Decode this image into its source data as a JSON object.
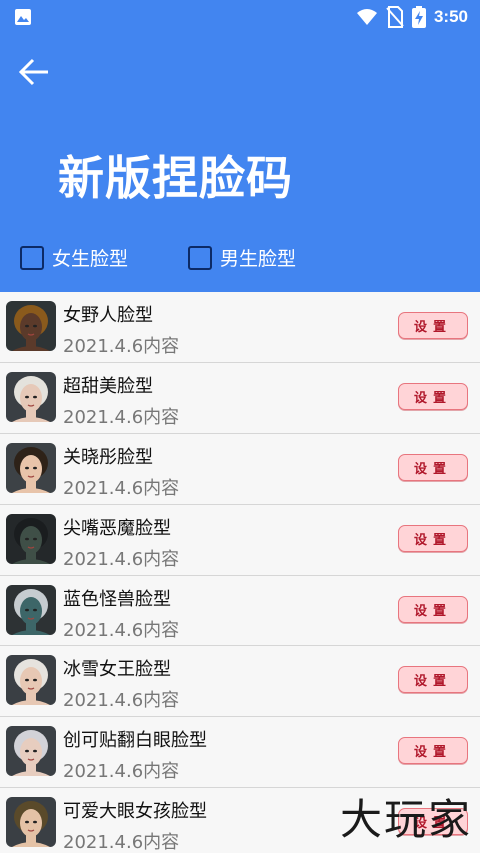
{
  "status_bar": {
    "time": "3:50"
  },
  "header": {
    "title": "新版捏脸码"
  },
  "filters": [
    {
      "label": "女生脸型",
      "checked": false
    },
    {
      "label": "男生脸型",
      "checked": false
    }
  ],
  "set_label": "设置",
  "items": [
    {
      "name": "女野人脸型",
      "date": "2021.4.6内容",
      "hair": "#8a5a1c",
      "skin": "#5b3a2a",
      "bg": "#2e3436"
    },
    {
      "name": "超甜美脸型",
      "date": "2021.4.6内容",
      "hair": "#e4e2dc",
      "skin": "#e6c9b8",
      "bg": "#3a3f44"
    },
    {
      "name": "关晓彤脸型",
      "date": "2021.4.6内容",
      "hair": "#2e2218",
      "skin": "#e8c4aa",
      "bg": "#3d4246"
    },
    {
      "name": "尖嘴恶魔脸型",
      "date": "2021.4.6内容",
      "hair": "#1a1d1f",
      "skin": "#3f4f47",
      "bg": "#24282a"
    },
    {
      "name": "蓝色怪兽脸型",
      "date": "2021.4.6内容",
      "hair": "#c6ccd0",
      "skin": "#3d6668",
      "bg": "#2d3234"
    },
    {
      "name": "冰雪女王脸型",
      "date": "2021.4.6内容",
      "hair": "#e6e3de",
      "skin": "#e7c8b4",
      "bg": "#3a3f44"
    },
    {
      "name": "创可贴翻白眼脸型",
      "date": "2021.4.6内容",
      "hair": "#d2d2d8",
      "skin": "#e7cdbf",
      "bg": "#3b4045"
    },
    {
      "name": "可爱大眼女孩脸型",
      "date": "2021.4.6内容",
      "hair": "#5a4a2a",
      "skin": "#e4c2a6",
      "bg": "#3a3f44"
    }
  ],
  "watermark": "大玩家",
  "colors": {
    "primary": "#4285f0",
    "button_bg": "#ffd4d7",
    "button_text": "#b0182b"
  }
}
